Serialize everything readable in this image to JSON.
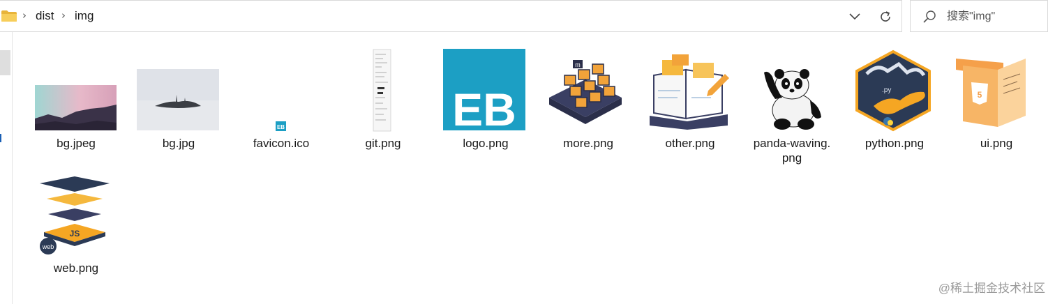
{
  "address_bar": {
    "breadcrumb": [
      "dist",
      "img"
    ]
  },
  "search": {
    "placeholder": "搜索\"img\""
  },
  "files": [
    {
      "name": "bg.jpeg",
      "icon": "landscape-thumbnail"
    },
    {
      "name": "bg.jpg",
      "icon": "foggy-island-thumbnail"
    },
    {
      "name": "favicon.ico",
      "icon": "eb-favicon-icon"
    },
    {
      "name": "git.png",
      "icon": "narrow-screenshot-thumbnail"
    },
    {
      "name": "logo.png",
      "icon": "eb-logo-thumbnail"
    },
    {
      "name": "more.png",
      "icon": "cube-grid-thumbnail"
    },
    {
      "name": "other.png",
      "icon": "notebook-thumbnail"
    },
    {
      "name": "panda-waving.png",
      "icon": "panda-thumbnail",
      "label_lines": [
        "panda-waving.",
        "png"
      ]
    },
    {
      "name": "python.png",
      "icon": "python-thumbnail"
    },
    {
      "name": "ui.png",
      "icon": "html5-ui-thumbnail"
    },
    {
      "name": "web.png",
      "icon": "web-js-layers-thumbnail"
    }
  ],
  "watermark": "@稀土掘金技术社区",
  "colors": {
    "folder": "#f5c242",
    "eb_teal": "#1c9fc4",
    "border": "#d9d9d9",
    "python_navy": "#2b3a55",
    "python_orange": "#f5a623"
  }
}
